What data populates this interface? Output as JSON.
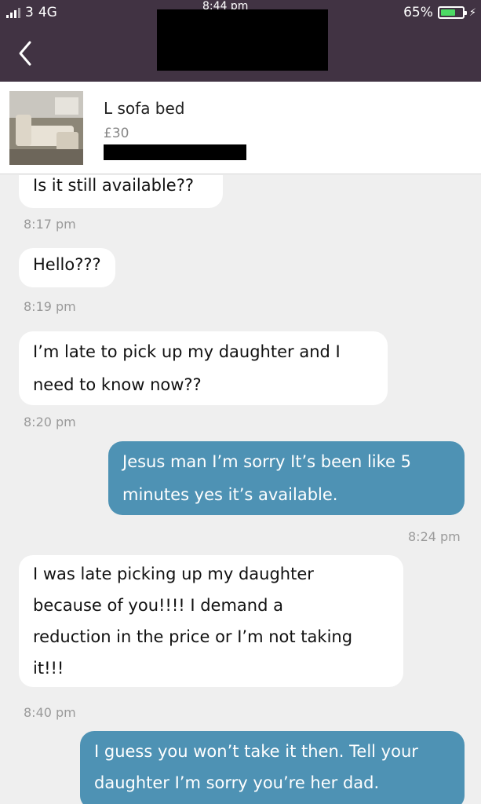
{
  "status_bar": {
    "carrier": "3",
    "network": "4G",
    "time_partial": "8:44 pm",
    "battery": "65%"
  },
  "listing": {
    "title": "L sofa bed",
    "price": "£30"
  },
  "messages": [
    {
      "text": "Is it still available??",
      "time": "8:17 pm",
      "direction": "incoming"
    },
    {
      "text": "Hello???",
      "time": "8:19 pm",
      "direction": "incoming"
    },
    {
      "lines": [
        "I’m late to pick up my daughter and I",
        "need to know now??"
      ],
      "time": "8:20 pm",
      "direction": "incoming"
    },
    {
      "lines": [
        "Jesus man I’m sorry It’s been like 5",
        "minutes yes it’s available."
      ],
      "time": "8:24 pm",
      "direction": "outgoing"
    },
    {
      "lines": [
        "I was late picking up my daughter",
        "because of you!!!! I demand a",
        "reduction in the price or I’m not taking",
        "it!!!"
      ],
      "time": "8:40 pm",
      "direction": "incoming"
    },
    {
      "lines": [
        "I guess you won’t take it then. Tell your",
        "daughter I’m sorry you’re her dad."
      ],
      "direction": "outgoing"
    }
  ],
  "colors": {
    "header_bg": "#413343",
    "outgoing_bubble": "#4e92b4",
    "incoming_bubble": "#ffffff",
    "chat_bg": "#efefef"
  },
  "icons": {
    "back": "chevron-left-icon",
    "signal": "signal-bars-icon",
    "battery": "battery-icon",
    "charging": "bolt-icon"
  }
}
